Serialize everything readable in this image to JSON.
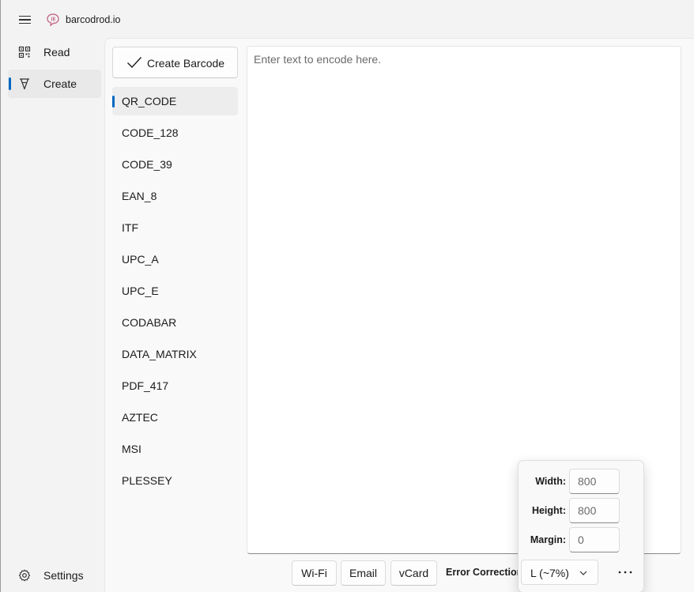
{
  "app": {
    "title": "barcodrod.io"
  },
  "nav": {
    "items": [
      {
        "label": "Read",
        "icon": "qr-icon"
      },
      {
        "label": "Create",
        "icon": "pen-icon",
        "selected": true
      }
    ],
    "settings_label": "Settings"
  },
  "create": {
    "button_label": "Create Barcode",
    "text_placeholder": "Enter text to encode here.",
    "formats": [
      "QR_CODE",
      "CODE_128",
      "CODE_39",
      "EAN_8",
      "ITF",
      "UPC_A",
      "UPC_E",
      "CODABAR",
      "DATA_MATRIX",
      "PDF_417",
      "AZTEC",
      "MSI",
      "PLESSEY"
    ],
    "selected_format": "QR_CODE"
  },
  "toolbar": {
    "wifi_label": "Wi-Fi",
    "email_label": "Email",
    "vcard_label": "vCard",
    "ec_label": "Error Correction:",
    "ec_value": "L (~7%)",
    "more_label": "···"
  },
  "options": {
    "width_label": "Width:",
    "width_placeholder": "800",
    "height_label": "Height:",
    "height_placeholder": "800",
    "margin_label": "Margin:",
    "margin_placeholder": "0"
  },
  "colors": {
    "accent": "#0067c0",
    "logo": "#c4708a"
  }
}
